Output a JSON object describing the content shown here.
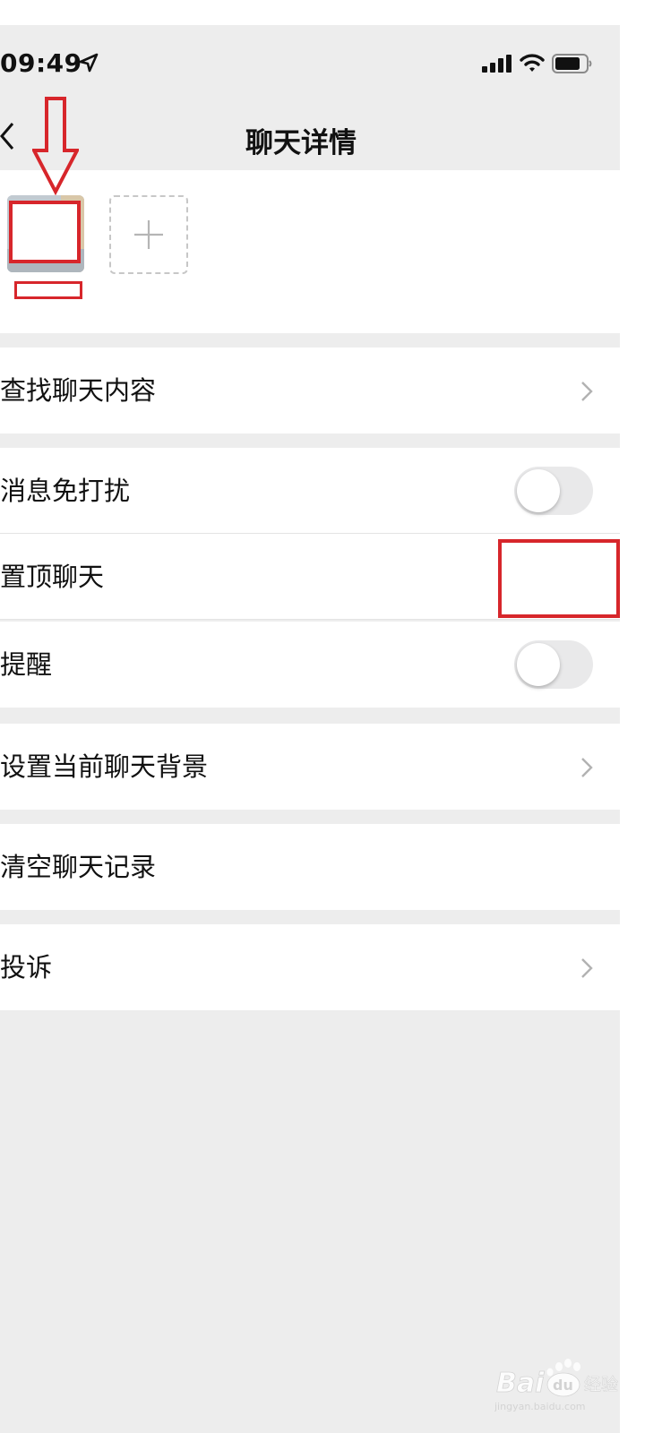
{
  "status_bar": {
    "time": "09:49",
    "icons": [
      "location-arrow-icon",
      "signal-icon",
      "wifi-icon",
      "battery-icon"
    ]
  },
  "nav": {
    "back_icon": "chevron-left-icon",
    "title": "聊天详情"
  },
  "members": {
    "avatar_icon": "avatar",
    "add_icon": "plus-icon"
  },
  "rows": {
    "search_chat": "查找聊天内容",
    "mute": "消息免打扰",
    "pin": "置顶聊天",
    "remind": "提醒",
    "background": "设置当前聊天背景",
    "clear": "清空聊天记录",
    "report": "投诉"
  },
  "toggles": {
    "mute": false,
    "remind": false
  },
  "annotation": {
    "color": "#d7262b"
  },
  "watermark": {
    "brand": "Bai",
    "paw_letters": "du",
    "cn": "经验",
    "url": "jingyan.baidu.com"
  },
  "colors": {
    "background": "#ededed",
    "card": "#ffffff",
    "chevron": "#b2b2b2",
    "toggle_off": "#e9e9ea"
  }
}
